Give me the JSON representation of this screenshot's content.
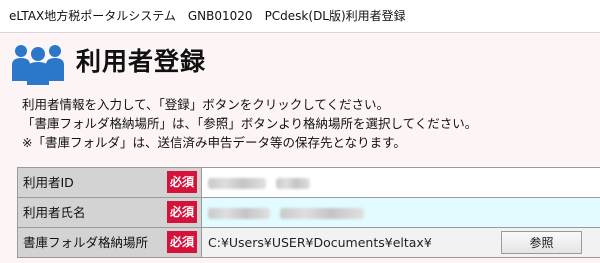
{
  "window": {
    "title": "eLTAX地方税ポータルシステム　GNB01020　PCdesk(DL版)利用者登録"
  },
  "header": {
    "icon": "users-icon",
    "title": "利用者登録",
    "icon_color": "#2b77c9"
  },
  "instructions": [
    "利用者情報を入力して、「登録」ボタンをクリックしてください。",
    "「書庫フォルダ格納場所」は、「参照」ボタンより格納場所を選択してください。",
    "※「書庫フォルダ」は、送信済み申告データ等の保存先となります。"
  ],
  "form": {
    "required_badge": "必須",
    "required_color": "#d4123a",
    "rows": [
      {
        "label": "利用者ID",
        "value": ""
      },
      {
        "label": "利用者氏名",
        "value": ""
      },
      {
        "label": "書庫フォルダ格納場所",
        "value": "C:¥Users¥USER¥Documents¥eltax¥",
        "button": "参照"
      }
    ]
  }
}
